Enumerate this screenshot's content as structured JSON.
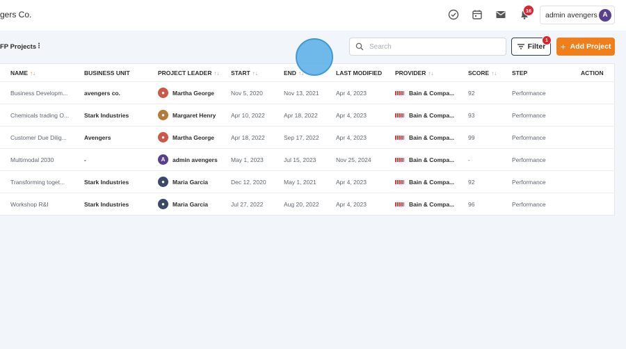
{
  "header": {
    "brand": "gers Co.",
    "user_name": "admin avengers",
    "notification_count": "16",
    "icons": [
      "check-circle-icon",
      "calendar-icon",
      "mail-icon",
      "bell-icon"
    ]
  },
  "toolbar": {
    "section_title": "FP Projects",
    "search_placeholder": "Search",
    "filter_label": "Filter",
    "filter_count": "1",
    "add_label": "Add Project"
  },
  "table": {
    "columns": [
      "NAME",
      "BUSINESS UNIT",
      "PROJECT LEADER",
      "START",
      "END",
      "LAST MODIFIED",
      "PROVIDER",
      "SCORE",
      "STEP",
      "ACTION"
    ],
    "rows": [
      {
        "name": "Business Developm...",
        "unit": "avengers co.",
        "leader": "Martha George",
        "start": "Nov 5, 2020",
        "end": "Nov 13, 2021",
        "modified": "Apr 4, 2023",
        "provider": "Bain & Compa...",
        "score": "92",
        "step": "Performance"
      },
      {
        "name": "Chemicals trading O...",
        "unit": "Stark Industries",
        "leader": "Margaret Henry",
        "start": "Apr 10, 2022",
        "end": "Apr 18, 2022",
        "modified": "Apr 4, 2023",
        "provider": "Bain & Compa...",
        "score": "93",
        "step": "Performance"
      },
      {
        "name": "Customer Due Dilig...",
        "unit": "Avengers",
        "leader": "Martha George",
        "start": "Apr 18, 2022",
        "end": "Sep 17, 2022",
        "modified": "Apr 4, 2023",
        "provider": "Bain & Compa...",
        "score": "99",
        "step": "Performance"
      },
      {
        "name": "Multimodal 2030",
        "unit": "-",
        "leader": "admin avengers",
        "start": "May 1, 2023",
        "end": "Jul 15, 2023",
        "modified": "Nov 25, 2024",
        "provider": "Bain & Compa...",
        "score": "-",
        "step": "Performance"
      },
      {
        "name": "Transforming toget...",
        "unit": "Stark Industries",
        "leader": "Maria Garcia",
        "start": "Dec 12, 2020",
        "end": "May 1, 2021",
        "modified": "Apr 4, 2023",
        "provider": "Bain & Compa...",
        "score": "92",
        "step": "Performance"
      },
      {
        "name": "Workshop R&I",
        "unit": "Stark Industries",
        "leader": "Maria Garcia",
        "start": "Jul 27, 2022",
        "end": "Aug 20, 2022",
        "modified": "Apr 4, 2023",
        "provider": "Bain & Compa...",
        "score": "96",
        "step": "Performance"
      }
    ]
  },
  "colors": {
    "accent": "#f07e1a",
    "badge": "#d9252f",
    "background": "#f2f5f9"
  }
}
